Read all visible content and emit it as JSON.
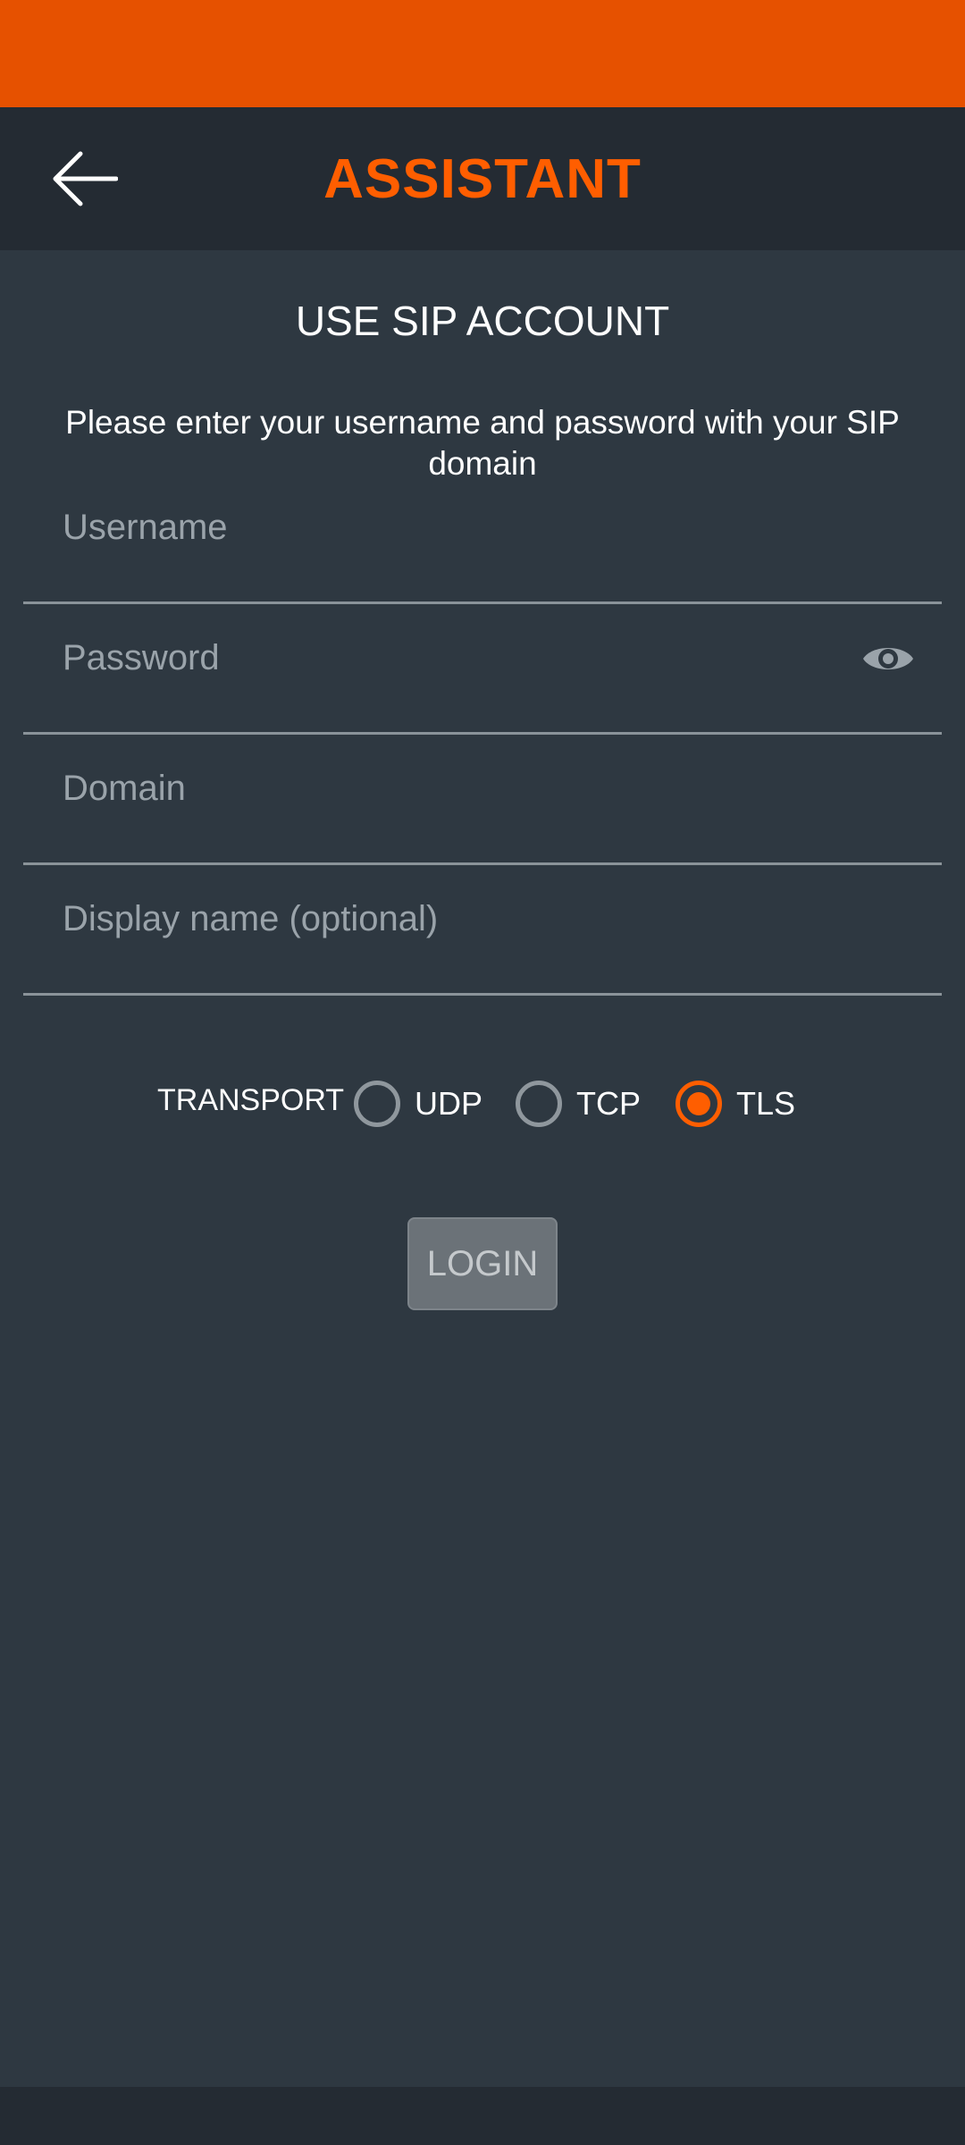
{
  "header": {
    "title": "ASSISTANT",
    "back_icon": "arrow-left-icon"
  },
  "main": {
    "section_title": "USE SIP ACCOUNT",
    "instructions": "Please enter your username and password with your SIP domain",
    "fields": {
      "username": {
        "placeholder": "Username",
        "value": ""
      },
      "password": {
        "placeholder": "Password",
        "value": "",
        "toggle_icon": "eye-icon"
      },
      "domain": {
        "placeholder": "Domain",
        "value": ""
      },
      "display_name": {
        "placeholder": "Display name (optional)",
        "value": ""
      }
    },
    "transport": {
      "label": "TRANSPORT",
      "options": [
        "UDP",
        "TCP",
        "TLS"
      ],
      "selected": "TLS"
    },
    "login_label": "LOGIN"
  },
  "colors": {
    "accent": "#ff5e00",
    "status_bar": "#e65100",
    "toolbar": "#242b33",
    "background": "#2e3841",
    "button_disabled": "#6b7278"
  }
}
